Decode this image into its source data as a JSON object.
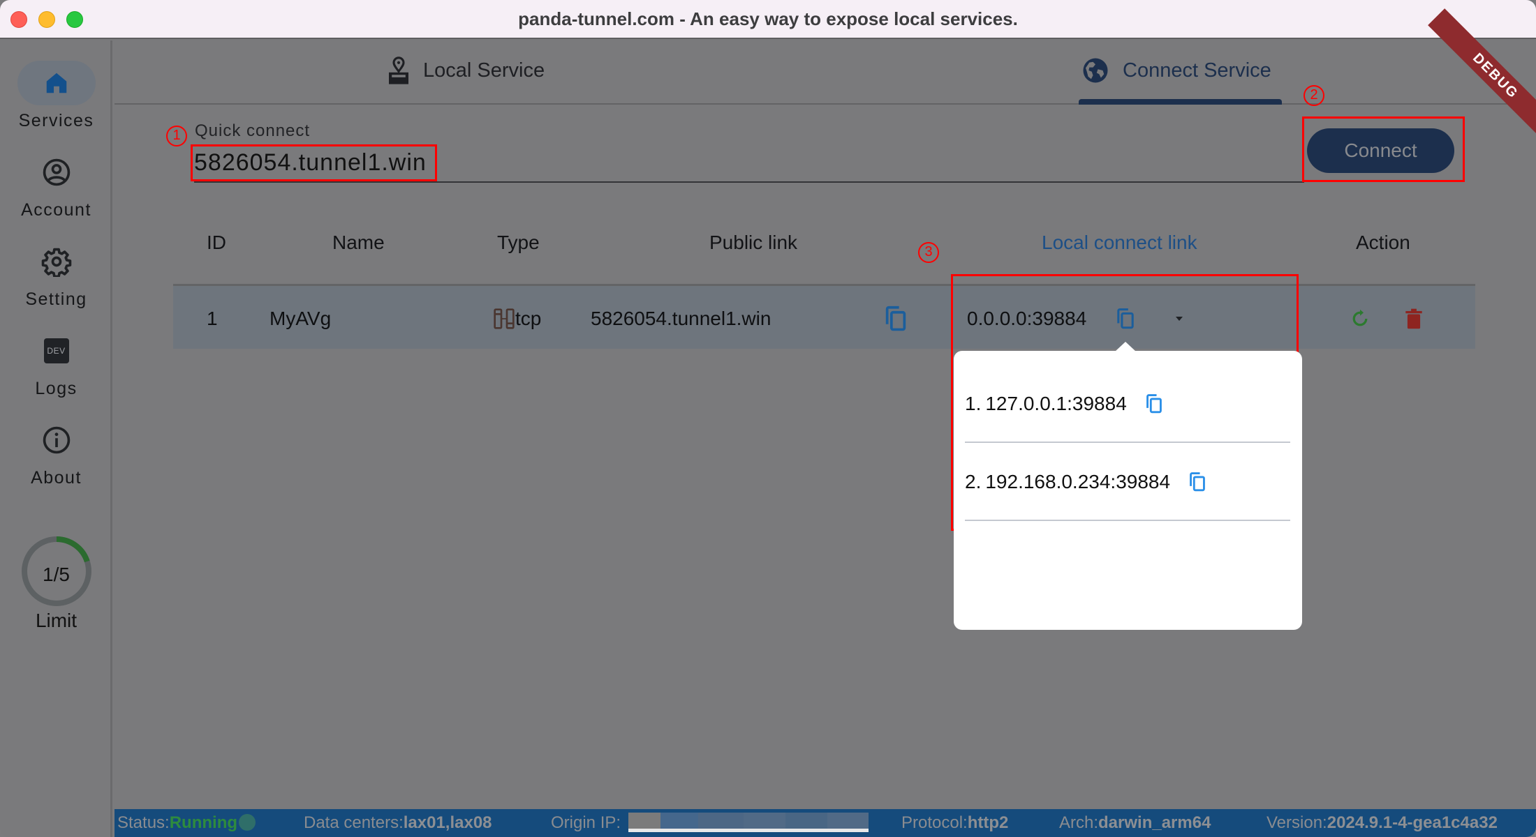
{
  "window": {
    "title": "panda-tunnel.com - An easy way to expose local services.",
    "debug_banner": "DEBUG"
  },
  "sidebar": {
    "items": [
      {
        "label": "Services",
        "icon": "home-icon",
        "active": true
      },
      {
        "label": "Account",
        "icon": "account-circle-icon",
        "active": false
      },
      {
        "label": "Setting",
        "icon": "gear-icon",
        "active": false
      },
      {
        "label": "Logs",
        "icon": "dev-badge-icon",
        "badge": "DEV",
        "active": false
      },
      {
        "label": "About",
        "icon": "info-icon",
        "active": false
      }
    ],
    "limit": {
      "text": "1/5",
      "label": "Limit",
      "used": 1,
      "total": 5
    }
  },
  "tabs": [
    {
      "label": "Local Service",
      "icon": "stamp-pin-icon",
      "active": false
    },
    {
      "label": "Connect Service",
      "icon": "globe-icon",
      "active": true
    }
  ],
  "quick_connect": {
    "label": "Quick connect",
    "value": "5826054.tunnel1.win",
    "button": "Connect"
  },
  "annotations": [
    "1",
    "2",
    "3"
  ],
  "table": {
    "headers": [
      "ID",
      "Name",
      "Type",
      "Public link",
      "Local connect link",
      "Action"
    ],
    "rows": [
      {
        "id": "1",
        "name": "MyAVg",
        "type": "tcp",
        "public_link": "5826054.tunnel1.win",
        "local_link": "0.0.0.0:39884"
      }
    ]
  },
  "local_links_popup": {
    "items": [
      {
        "num": "1.",
        "address": "127.0.0.1:39884"
      },
      {
        "num": "2.",
        "address": "192.168.0.234:39884"
      }
    ]
  },
  "status_bar": {
    "status_label": "Status:",
    "status_value": "Running",
    "datacenters_label": "Data centers:",
    "datacenters_value": "lax01,lax08",
    "origin_ip_label": "Origin IP:",
    "protocol_label": "Protocol:",
    "protocol_value": "http2",
    "arch_label": "Arch:",
    "arch_value": "darwin_arm64",
    "version_label": "Version:",
    "version_value": "2024.9.1-4-gea1c4a32"
  },
  "colors": {
    "accent_navy": "#1c2f4d",
    "link_blue": "#1d4f86",
    "copy_blue": "#2a8fe8",
    "running_green": "#2e8b3e",
    "delete_red": "#8e2420",
    "annotation_red": "#ff0000",
    "statusbar_blue": "#154b7c"
  }
}
